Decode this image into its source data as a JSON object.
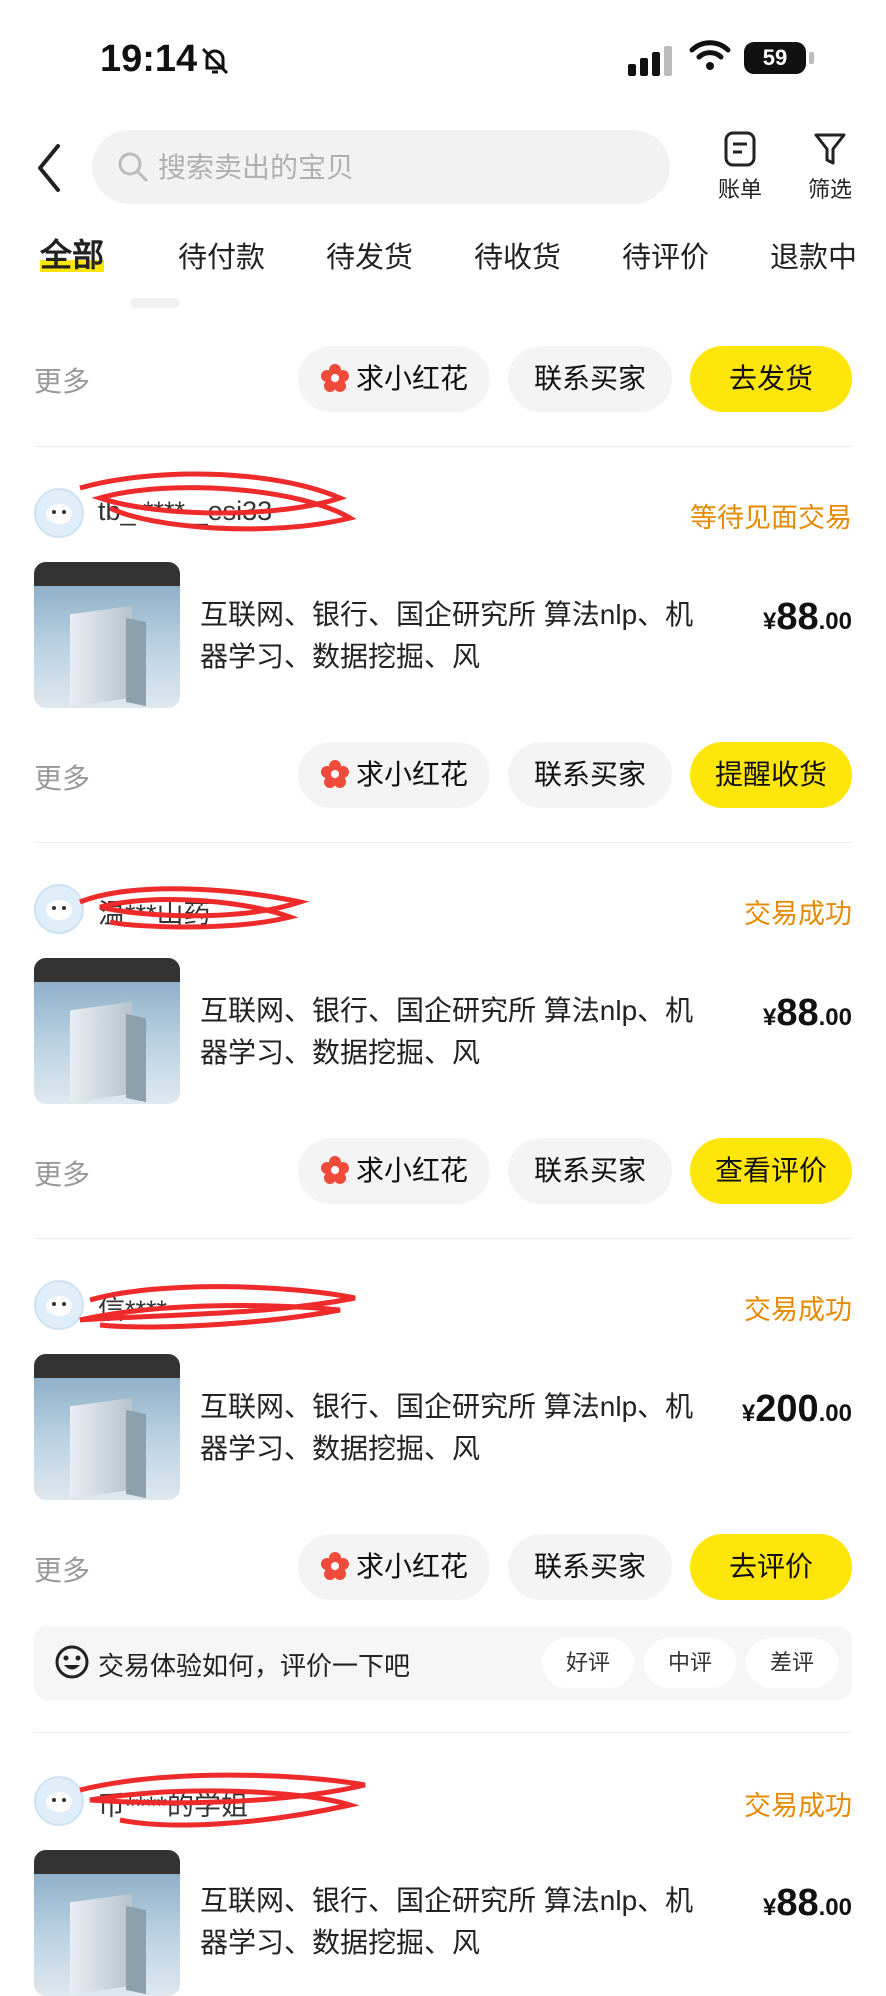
{
  "status_bar": {
    "time": "19:14",
    "battery": "59"
  },
  "header": {
    "search_placeholder": "搜索卖出的宝贝",
    "bill_label": "账单",
    "filter_label": "筛选"
  },
  "tabs": [
    "全部",
    "待付款",
    "待发货",
    "待收货",
    "待评价",
    "退款中"
  ],
  "actions": {
    "more": "更多",
    "flower": "求小红花",
    "contact": "联系买家"
  },
  "first_card": {
    "primary": "去发货"
  },
  "orders": [
    {
      "buyer": "tb_ **** _esi33",
      "status": "等待见面交易",
      "title": "互联网、银行、国企研究所 算法nlp、机器学习、数据挖掘、风",
      "price_cur": "¥",
      "price_int": "88",
      "price_dec": ".00",
      "primary": "提醒收货"
    },
    {
      "buyer": "温***山药",
      "status": "交易成功",
      "title": "互联网、银行、国企研究所 算法nlp、机器学习、数据挖掘、风",
      "price_cur": "¥",
      "price_int": "88",
      "price_dec": ".00",
      "primary": "查看评价"
    },
    {
      "buyer": "信****",
      "status": "交易成功",
      "title": "互联网、银行、国企研究所 算法nlp、机器学习、数据挖掘、风",
      "price_cur": "¥",
      "price_int": "200",
      "price_dec": ".00",
      "primary": "去评价"
    },
    {
      "buyer": "币****的学姐",
      "status": "交易成功",
      "title": "互联网、银行、国企研究所 算法nlp、机器学习、数据挖掘、风",
      "price_cur": "¥",
      "price_int": "88",
      "price_dec": ".00"
    }
  ],
  "rating_prompt": {
    "text": "交易体验如何，评价一下吧",
    "good": "好评",
    "neutral": "中评",
    "bad": "差评"
  },
  "colors": {
    "accent": "#ffe60a",
    "status": "#e68a00",
    "muted": "#999999"
  }
}
